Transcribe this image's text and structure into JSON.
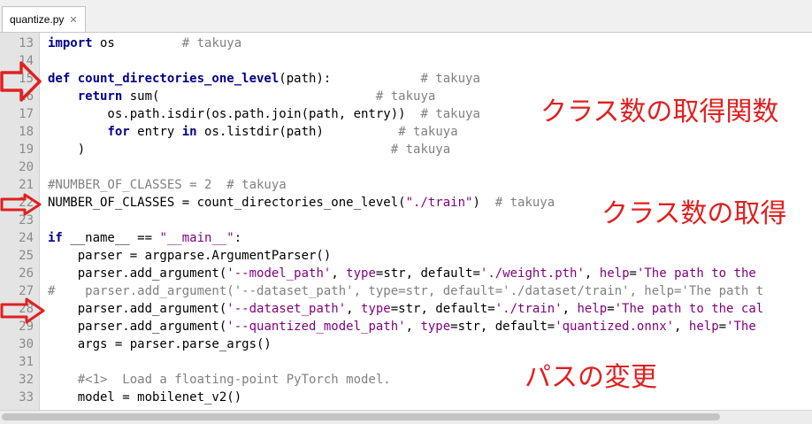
{
  "tab": {
    "title": "quantize.py",
    "close_glyph": "✕"
  },
  "lines": [
    {
      "n": "13",
      "segs": [
        {
          "t": "import",
          "c": "kw"
        },
        {
          "t": " os         "
        },
        {
          "t": "# takuya",
          "c": "cm"
        }
      ]
    },
    {
      "n": "14",
      "segs": []
    },
    {
      "n": "15",
      "segs": [
        {
          "t": "def ",
          "c": "kw"
        },
        {
          "t": "count_directories_one_level",
          "c": "fn"
        },
        {
          "t": "(path):            "
        },
        {
          "t": "# takuya",
          "c": "cm"
        }
      ]
    },
    {
      "n": "16",
      "segs": [
        {
          "t": "    "
        },
        {
          "t": "return",
          "c": "kw"
        },
        {
          "t": " sum(                             "
        },
        {
          "t": "# takuya",
          "c": "cm"
        }
      ]
    },
    {
      "n": "17",
      "segs": [
        {
          "t": "        os.path.isdir(os.path.join(path, entry))  "
        },
        {
          "t": "# takuya",
          "c": "cm"
        }
      ]
    },
    {
      "n": "18",
      "segs": [
        {
          "t": "        "
        },
        {
          "t": "for",
          "c": "kw"
        },
        {
          "t": " entry "
        },
        {
          "t": "in",
          "c": "kw"
        },
        {
          "t": " os.listdir(path)          "
        },
        {
          "t": "# takuya",
          "c": "cm"
        }
      ]
    },
    {
      "n": "19",
      "segs": [
        {
          "t": "    )                                         "
        },
        {
          "t": "# takuya",
          "c": "cm"
        }
      ]
    },
    {
      "n": "20",
      "segs": []
    },
    {
      "n": "21",
      "segs": [
        {
          "t": "#NUMBER_OF_CLASSES = 2  # takuya",
          "c": "cm"
        }
      ]
    },
    {
      "n": "22",
      "segs": [
        {
          "t": "NUMBER_OF_CLASSES = count_directories_one_level("
        },
        {
          "t": "\"./train\"",
          "c": "str"
        },
        {
          "t": ")  "
        },
        {
          "t": "# takuya",
          "c": "cm"
        }
      ]
    },
    {
      "n": "23",
      "segs": []
    },
    {
      "n": "24",
      "segs": [
        {
          "t": "if",
          "c": "kw"
        },
        {
          "t": " __name__ == "
        },
        {
          "t": "\"__main__\"",
          "c": "str"
        },
        {
          "t": ":"
        }
      ]
    },
    {
      "n": "25",
      "segs": [
        {
          "t": "    parser = argparse.ArgumentParser()"
        }
      ]
    },
    {
      "n": "26",
      "segs": [
        {
          "t": "    parser.add_argument("
        },
        {
          "t": "'--model_path'",
          "c": "str"
        },
        {
          "t": ", "
        },
        {
          "t": "type",
          "c": "str"
        },
        {
          "t": "=str, default="
        },
        {
          "t": "'./weight.pth'",
          "c": "str"
        },
        {
          "t": ", "
        },
        {
          "t": "help",
          "c": "str"
        },
        {
          "t": "="
        },
        {
          "t": "'The path to the",
          "c": "str"
        }
      ]
    },
    {
      "n": "27",
      "segs": [
        {
          "t": "#    parser.add_argument('--dataset_path', type=str, default='./dataset/train', help='The path t",
          "c": "cm"
        }
      ]
    },
    {
      "n": "28",
      "segs": [
        {
          "t": "    parser.add_argument("
        },
        {
          "t": "'--dataset_path'",
          "c": "str"
        },
        {
          "t": ", "
        },
        {
          "t": "type",
          "c": "str"
        },
        {
          "t": "=str, default="
        },
        {
          "t": "'./train'",
          "c": "str"
        },
        {
          "t": ", "
        },
        {
          "t": "help",
          "c": "str"
        },
        {
          "t": "="
        },
        {
          "t": "'The path to the cal",
          "c": "str"
        }
      ]
    },
    {
      "n": "29",
      "segs": [
        {
          "t": "    parser.add_argument("
        },
        {
          "t": "'--quantized_model_path'",
          "c": "str"
        },
        {
          "t": ", "
        },
        {
          "t": "type",
          "c": "str"
        },
        {
          "t": "=str, default="
        },
        {
          "t": "'quantized.onnx'",
          "c": "str"
        },
        {
          "t": ", "
        },
        {
          "t": "help",
          "c": "str"
        },
        {
          "t": "="
        },
        {
          "t": "'The",
          "c": "str"
        }
      ]
    },
    {
      "n": "30",
      "segs": [
        {
          "t": "    args = parser.parse_args()"
        }
      ]
    },
    {
      "n": "31",
      "segs": []
    },
    {
      "n": "32",
      "segs": [
        {
          "t": "    #<1>  Load a floating-point PyTorch model.",
          "c": "cm"
        }
      ]
    },
    {
      "n": "33",
      "segs": [
        {
          "t": "    model = mobilenet_v2()"
        }
      ]
    }
  ],
  "annotations": {
    "class_count_func": "クラス数の取得関数",
    "class_count_get": "クラス数の取得",
    "path_change": "パスの変更"
  },
  "colors": {
    "accent_red": "#e02020",
    "keyword": "#00008b",
    "string": "#7f007f",
    "comment": "#808080"
  }
}
